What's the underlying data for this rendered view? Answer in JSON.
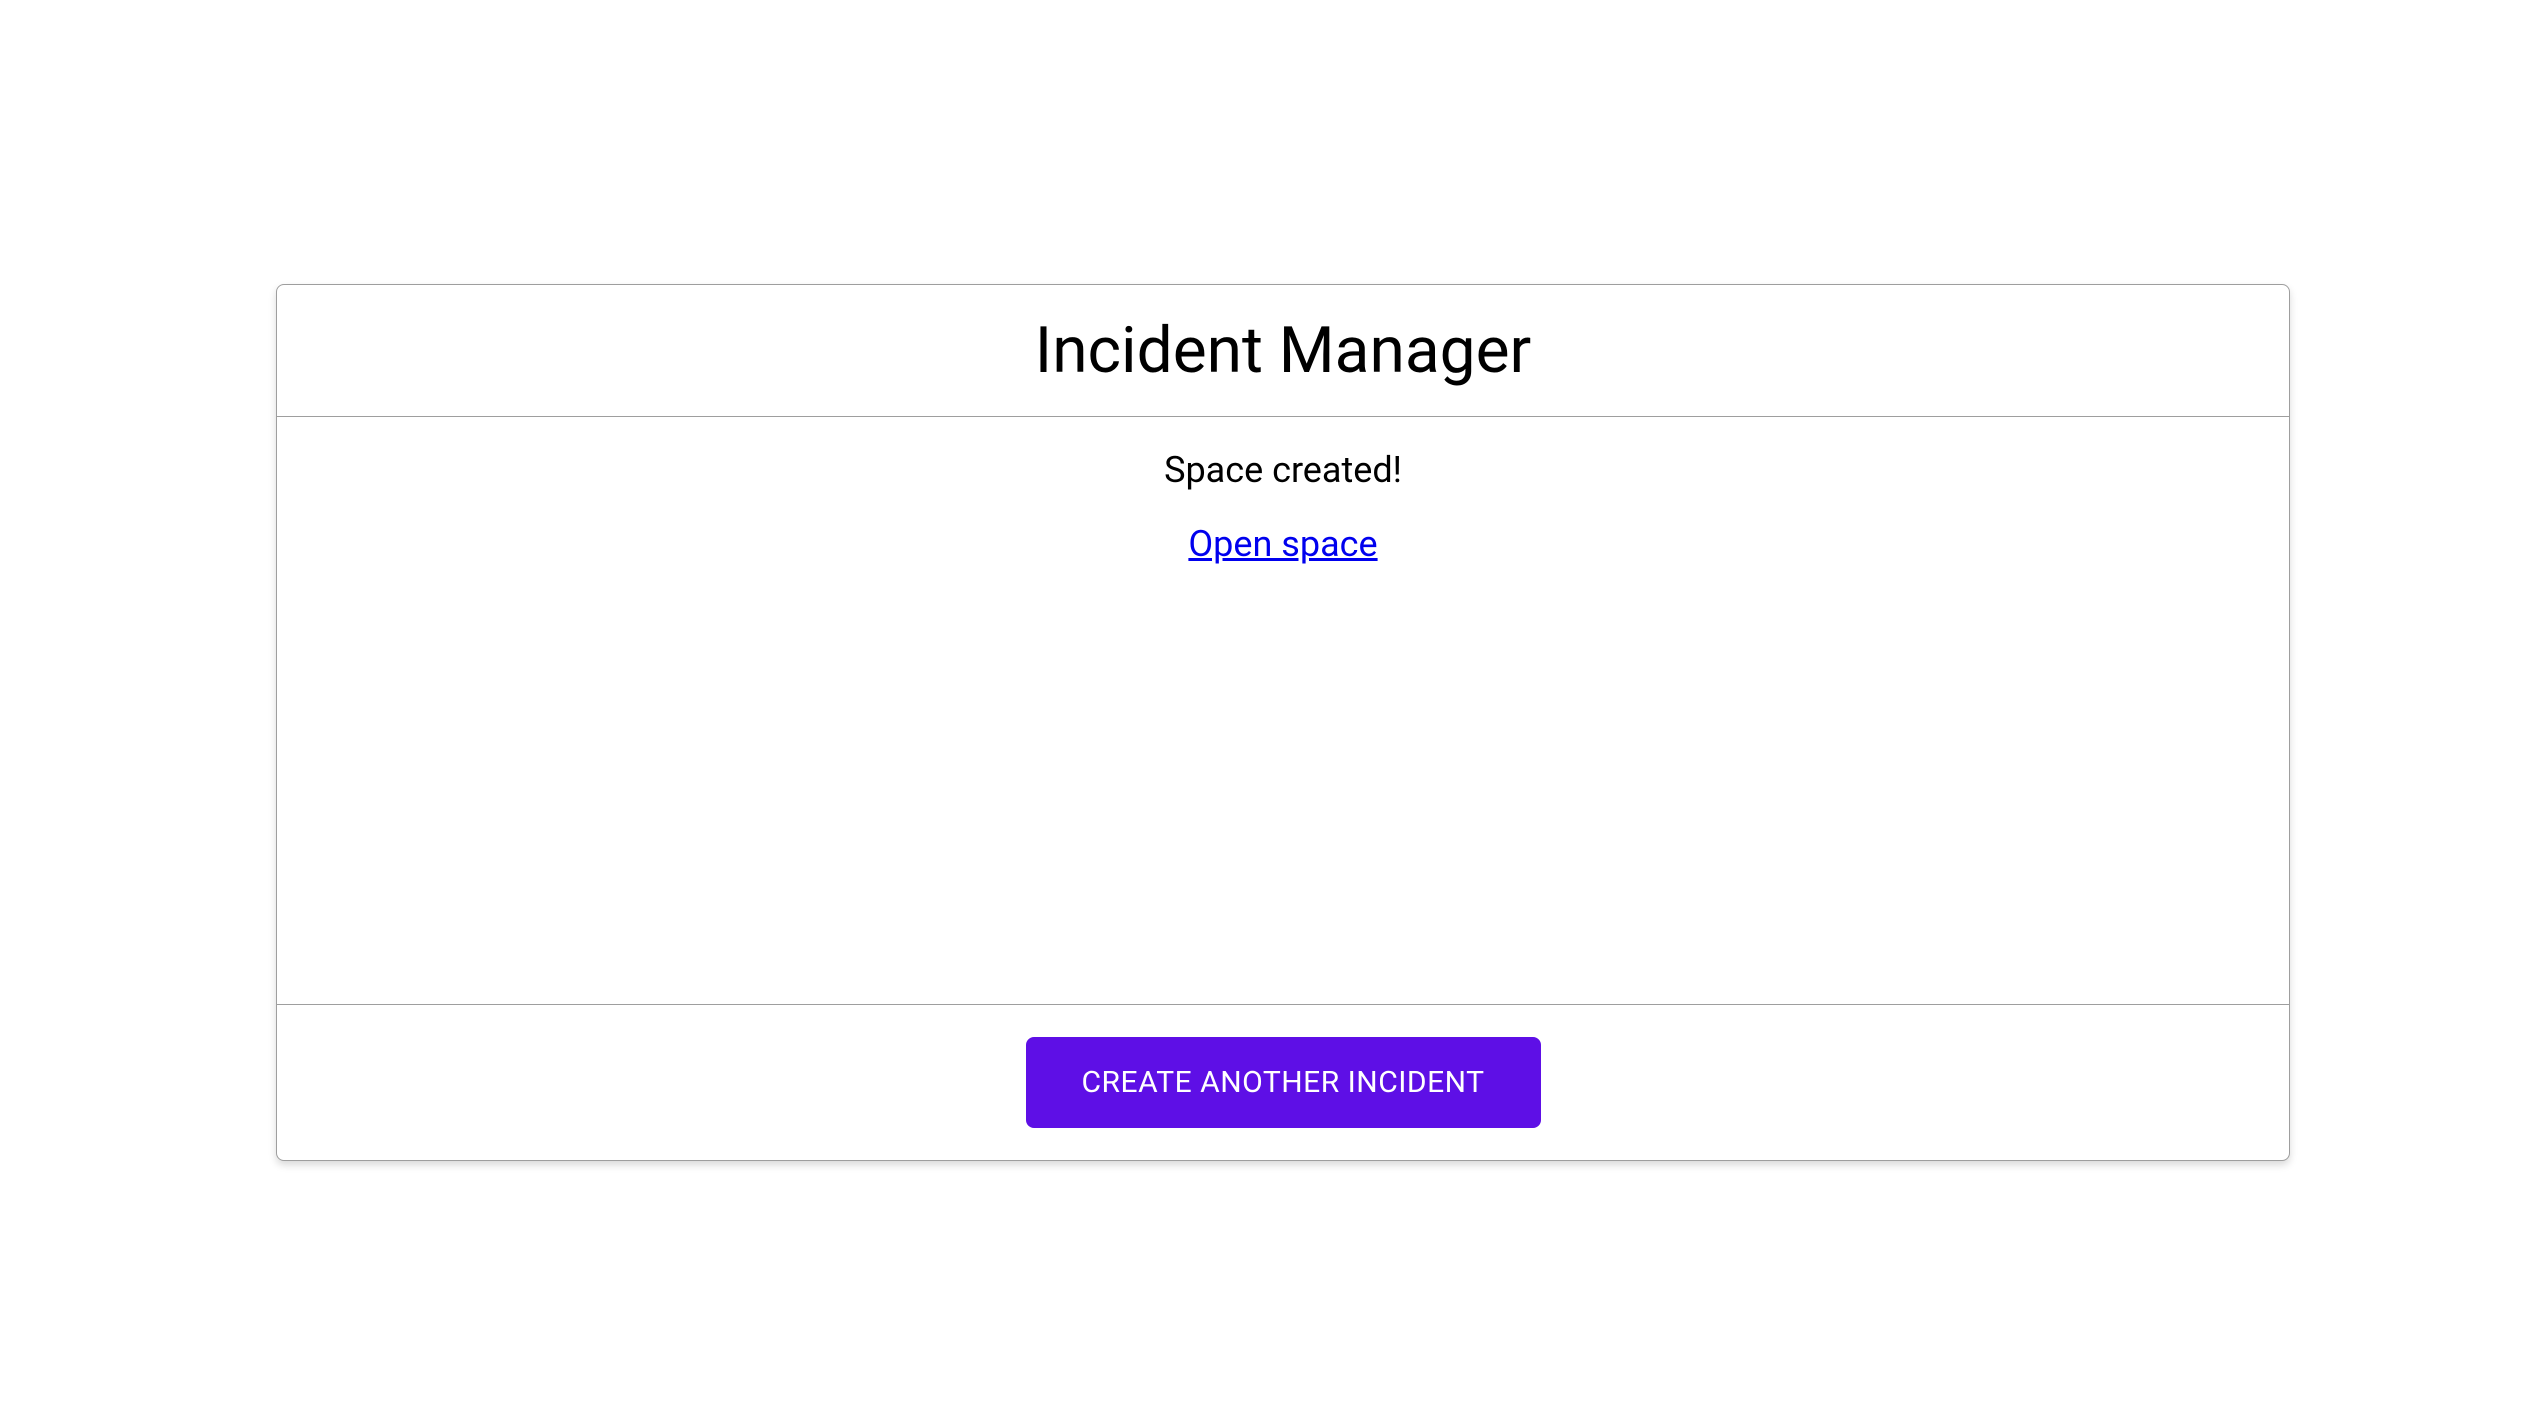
{
  "card": {
    "title": "Incident Manager",
    "status_message": "Space created!",
    "link_text": "Open space",
    "button_label": "CREATE ANOTHER INCIDENT"
  },
  "colors": {
    "primary": "#5e0fe6",
    "link": "#0000ee",
    "border": "#9e9e9e"
  }
}
